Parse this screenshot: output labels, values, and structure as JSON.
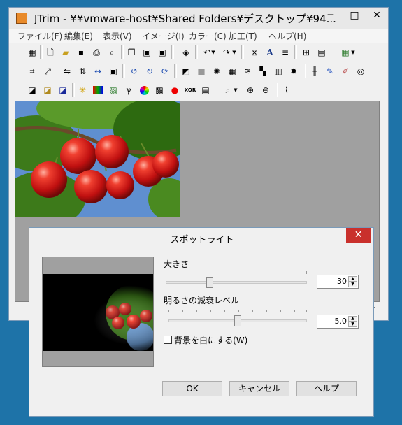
{
  "window": {
    "title": "JTrim - ¥¥vmware-host¥Shared Folders¥デスクトップ¥94...",
    "minimize": "─",
    "maximize": "□",
    "close": "✕"
  },
  "menu": [
    "ファイル(F)",
    "編集(E)",
    "表示(V)",
    "イメージ(I)",
    "カラー(C)",
    "加工(T)",
    "ヘルプ(H)"
  ],
  "toolbar": {
    "row1": [
      "new-icon",
      "open-icon",
      "save-icon",
      "print-icon",
      "print-preview-icon",
      "copy-icon",
      "paste-icon",
      "paste-new-icon",
      "capture-icon",
      "undo-icon",
      "redo-icon",
      "fit-icon",
      "text-icon",
      "stripes-icon",
      "grid-icon",
      "film-icon",
      "palette-icon"
    ],
    "row2": [
      "crop-icon",
      "resize-icon",
      "flip-h-icon",
      "flip-v-icon",
      "shift-icon",
      "frame-icon",
      "rotate-left-icon",
      "rotate-right-icon",
      "rotate-free-icon",
      "shadow-icon",
      "emboss-icon",
      "spotlight-icon",
      "mosaic-icon",
      "wave-icon",
      "relief-icon",
      "brick-icon",
      "blur-icon",
      "glass-icon",
      "pen-icon",
      "edit-icon",
      "swirl-icon"
    ],
    "row3": [
      "gradient-icon",
      "gold-icon",
      "blue-icon",
      "sparkle-icon",
      "rgb-icon",
      "image-icon",
      "gamma-icon",
      "color-wheel-icon",
      "checker-icon",
      "rgb-dots-icon",
      "xor-icon",
      "gray-icon",
      "zoom-icon",
      "zoom-in-icon",
      "zoom-out-icon",
      "eyedropper-icon"
    ]
  },
  "statusbar": {
    "right_char": "t"
  },
  "dialog": {
    "title": "スポットライト",
    "close": "✕",
    "size_label": "大きさ",
    "size_value": "30",
    "size_level": 0.3,
    "falloff_label": "明るさの減衰レベル",
    "falloff_value": "5.0",
    "falloff_level": 0.5,
    "white_bg_label": "背景を白にする(W)",
    "white_bg_checked": false,
    "ok": "OK",
    "cancel": "キャンセル",
    "help": "ヘルプ"
  },
  "colors": {
    "desktop": "#1e73a8",
    "close_red": "#c9302c",
    "canvas_gray": "#a0a0a0"
  }
}
